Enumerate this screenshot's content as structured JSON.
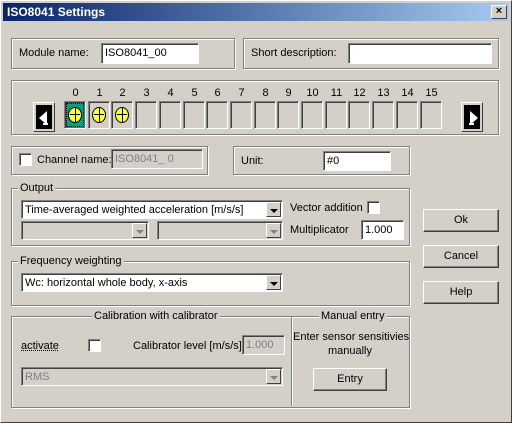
{
  "window": {
    "title": "ISO8041 Settings",
    "close_glyph": "×"
  },
  "module": {
    "name_label": "Module name:",
    "name_value": "ISO8041_00",
    "desc_label": "Short description:",
    "desc_value": ""
  },
  "channels": {
    "numbers": [
      "0",
      "1",
      "2",
      "3",
      "4",
      "5",
      "6",
      "7",
      "8",
      "9",
      "10",
      "11",
      "12",
      "13",
      "14",
      "15"
    ],
    "selected_index": 0,
    "active_count": 3
  },
  "channel": {
    "name_label": "Channel name:",
    "name_value": "ISO8041_ 0",
    "unit_label": "Unit:",
    "unit_value": "#0"
  },
  "output": {
    "legend": "Output",
    "measure": "Time-averaged weighted acceleration [m/s/s]",
    "sub1": "",
    "sub2": "",
    "vector_label": "Vector addition",
    "mult_label": "Multiplicator",
    "mult_value": "1.000"
  },
  "freq": {
    "legend": "Frequency weighting",
    "value": "Wc: horizontal whole body, x-axis"
  },
  "calib": {
    "legend": "Calibration with calibrator",
    "activate_label": "activate",
    "level_label": "Calibrator level [m/s/s]",
    "level_value": "1.000",
    "mode_value": "RMS"
  },
  "manual": {
    "legend": "Manual entry",
    "text1": "Enter sensor sensitivies",
    "text2": "manually",
    "entry_button": "Entry"
  },
  "buttons": {
    "ok": "Ok",
    "cancel": "Cancel",
    "help": "Help"
  },
  "colors": {
    "title_start": "#0a246a",
    "title_end": "#a6caf0",
    "face": "#d4d0c8",
    "selected_channel": "#00a080",
    "channel_icon": "#ffff40"
  }
}
